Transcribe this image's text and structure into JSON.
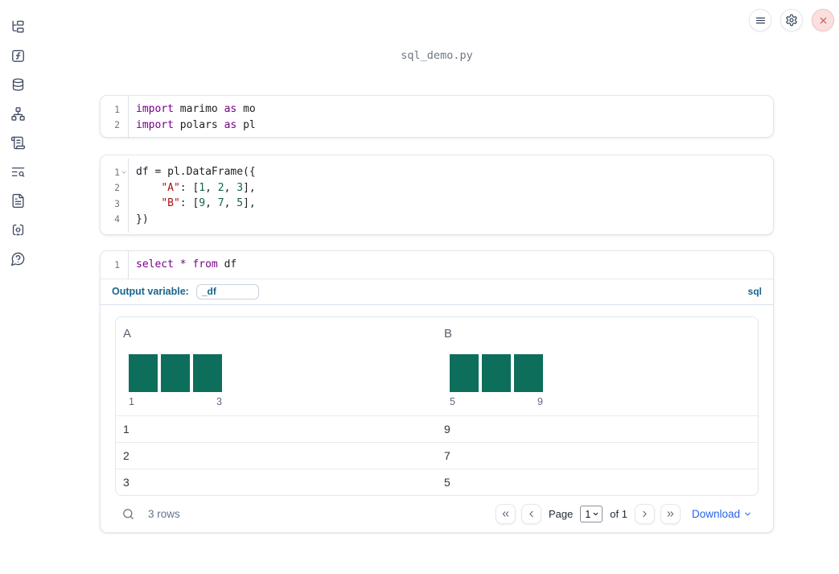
{
  "window": {
    "title": "sql_demo.py"
  },
  "topbar": {
    "buttons": [
      {
        "icon": "menu"
      },
      {
        "icon": "settings"
      },
      {
        "icon": "close"
      }
    ]
  },
  "sidebar": {
    "items": [
      {
        "icon": "file-tree"
      },
      {
        "icon": "function-square"
      },
      {
        "icon": "database"
      },
      {
        "icon": "hierarchy"
      },
      {
        "icon": "scroll"
      },
      {
        "icon": "list-search"
      },
      {
        "icon": "document"
      },
      {
        "icon": "code-snippet"
      },
      {
        "icon": "help-circle"
      }
    ]
  },
  "cells": {
    "imports": {
      "lines": [
        {
          "num": "1",
          "tokens": [
            {
              "c": "kw",
              "t": "import"
            },
            {
              "c": "pl",
              "t": " marimo "
            },
            {
              "c": "kw",
              "t": "as"
            },
            {
              "c": "pl",
              "t": " mo"
            }
          ]
        },
        {
          "num": "2",
          "tokens": [
            {
              "c": "kw",
              "t": "import"
            },
            {
              "c": "pl",
              "t": " polars "
            },
            {
              "c": "kw",
              "t": "as"
            },
            {
              "c": "pl",
              "t": " pl"
            }
          ]
        }
      ]
    },
    "dataframe": {
      "lines": [
        {
          "num": "1",
          "tokens": [
            {
              "c": "pl",
              "t": "df = pl.DataFrame({"
            }
          ]
        },
        {
          "num": "2",
          "tokens": [
            {
              "c": "pl",
              "t": "    "
            },
            {
              "c": "st",
              "t": "\"A\""
            },
            {
              "c": "pl",
              "t": ": ["
            },
            {
              "c": "nu",
              "t": "1"
            },
            {
              "c": "pl",
              "t": ", "
            },
            {
              "c": "nu",
              "t": "2"
            },
            {
              "c": "pl",
              "t": ", "
            },
            {
              "c": "nu",
              "t": "3"
            },
            {
              "c": "pl",
              "t": "],"
            }
          ]
        },
        {
          "num": "3",
          "tokens": [
            {
              "c": "pl",
              "t": "    "
            },
            {
              "c": "st",
              "t": "\"B\""
            },
            {
              "c": "pl",
              "t": ": ["
            },
            {
              "c": "nu",
              "t": "9"
            },
            {
              "c": "pl",
              "t": ", "
            },
            {
              "c": "nu",
              "t": "7"
            },
            {
              "c": "pl",
              "t": ", "
            },
            {
              "c": "nu",
              "t": "5"
            },
            {
              "c": "pl",
              "t": "],"
            }
          ]
        },
        {
          "num": "4",
          "tokens": [
            {
              "c": "pl",
              "t": "})"
            }
          ]
        }
      ]
    },
    "sql": {
      "lines": [
        {
          "num": "1",
          "tokens": [
            {
              "c": "kw",
              "t": "select"
            },
            {
              "c": "pl",
              "t": " "
            },
            {
              "c": "kw",
              "t": "*"
            },
            {
              "c": "pl",
              "t": " "
            },
            {
              "c": "kw",
              "t": "from"
            },
            {
              "c": "pl",
              "t": " df"
            }
          ]
        }
      ],
      "output_variable_label": "Output variable:",
      "output_variable_value": "_df",
      "language_badge": "sql"
    }
  },
  "table": {
    "columns": [
      {
        "header": "A",
        "histogram": {
          "values": [
            1,
            1,
            1
          ],
          "min_label": "1",
          "max_label": "3"
        }
      },
      {
        "header": "B",
        "histogram": {
          "values": [
            1,
            1,
            1
          ],
          "min_label": "5",
          "max_label": "9"
        }
      }
    ],
    "rows": [
      [
        "1",
        "9"
      ],
      [
        "2",
        "7"
      ],
      [
        "3",
        "5"
      ]
    ],
    "footer": {
      "row_count": "3 rows",
      "page_label": "Page",
      "page_value": "1",
      "of_label": "of 1",
      "download_label": "Download"
    }
  },
  "colors": {
    "histogram_bar": "#0e6e5c",
    "sql_accent": "#17658f",
    "download_link": "#2563eb",
    "keyword": "#770088",
    "string": "#aa1111",
    "number": "#116644"
  }
}
